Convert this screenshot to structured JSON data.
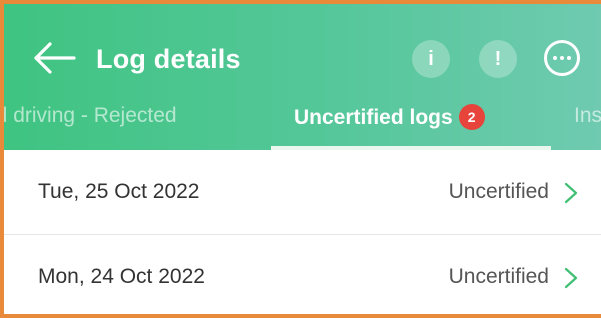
{
  "header": {
    "title": "Log details",
    "back_icon": "arrow-left-icon",
    "info_icon_glyph": "i",
    "alert_icon_glyph": "!",
    "more_icon": "more-horizontal-icon"
  },
  "tabs": {
    "prev_label": "ed driving - Rejected",
    "active_label": "Uncertified logs",
    "active_badge": "2",
    "next_label": "Ins"
  },
  "logs": [
    {
      "date": "Tue, 25 Oct 2022",
      "status": "Uncertified"
    },
    {
      "date": "Mon, 24 Oct 2022",
      "status": "Uncertified"
    }
  ],
  "colors": {
    "header_start": "#3fc481",
    "header_end": "#6fcab0",
    "badge": "#e7443b",
    "chevron": "#3fbf73",
    "frame": "#e98a3a"
  }
}
